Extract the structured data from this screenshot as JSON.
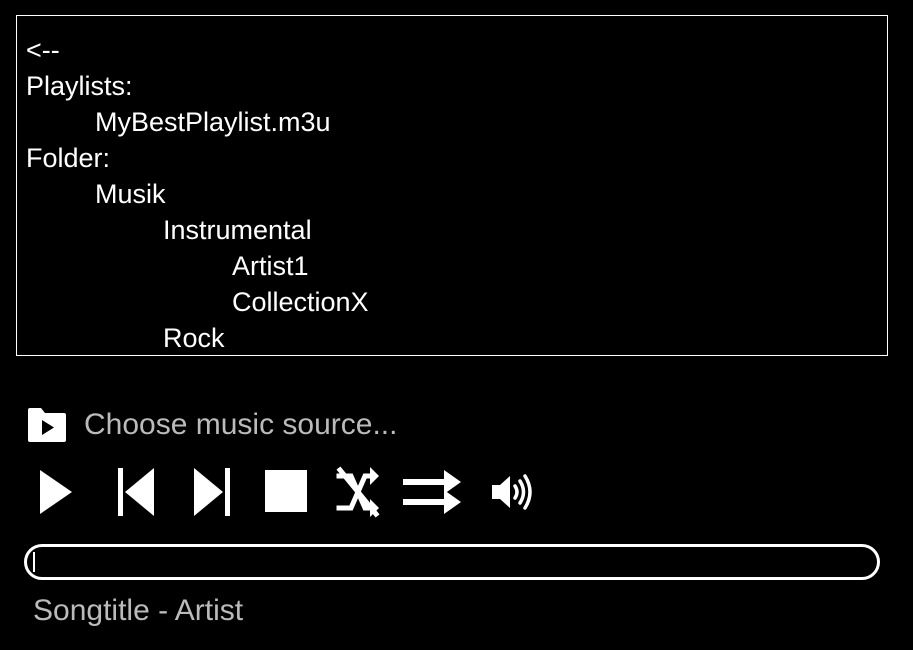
{
  "colors": {
    "background": "#000000",
    "foreground": "#ffffff",
    "muted_text": "#bbbbbb"
  },
  "browser": {
    "back_label": "<--",
    "playlists_header": "Playlists:",
    "playlists": [
      "MyBestPlaylist.m3u"
    ],
    "folder_header": "Folder:",
    "folders": {
      "root": "Musik",
      "sub1": "Instrumental",
      "sub1_children": [
        "Artist1",
        "CollectionX"
      ],
      "sub2": "Rock"
    }
  },
  "source": {
    "icon": "folder-play-icon",
    "label": "Choose music source..."
  },
  "controls": {
    "icons": [
      "play-icon",
      "previous-icon",
      "next-icon",
      "stop-icon",
      "shuffle-off-icon",
      "repeat-icon",
      "volume-icon"
    ]
  },
  "progress": {
    "fraction": 0.0
  },
  "now_playing": {
    "text": "Songtitle - Artist"
  }
}
